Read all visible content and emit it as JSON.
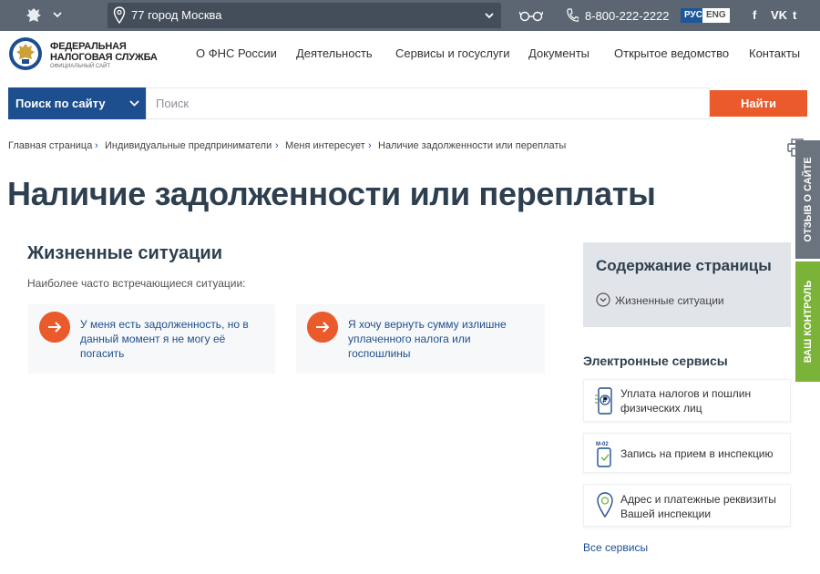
{
  "topbar": {
    "region": "77 город Москва",
    "phone": "8-800-222-2222",
    "lang_ru": "РУС",
    "lang_en": "ENG",
    "social": {
      "facebook": "f",
      "vk": "VK",
      "twitter": "t"
    }
  },
  "header": {
    "logo_line1": "ФЕДЕРАЛЬНАЯ",
    "logo_line2": "НАЛОГОВАЯ СЛУЖБА",
    "logo_line3": "ОФИЦИАЛЬНЫЙ САЙТ",
    "nav": [
      "О ФНС России",
      "Деятельность",
      "Сервисы и госуслуги",
      "Документы",
      "Открытое ведомство",
      "Контакты"
    ]
  },
  "search": {
    "scope": "Поиск по сайту",
    "placeholder": "Поиск",
    "button": "Найти"
  },
  "breadcrumb": [
    "Главная страница",
    "Индивидуальные предприниматели",
    "Меня интересует",
    "Наличие задолженности или переплаты"
  ],
  "side_tabs": {
    "feedback": "ОТЗЫВ О САЙТЕ",
    "control": "ВАШ КОНТРОЛЬ"
  },
  "page_title": "Наличие задолженности или переплаты",
  "main": {
    "section_title": "Жизненные ситуации",
    "section_sub": "Наиболее часто встречающиеся ситуации:",
    "cards": [
      {
        "lines": [
          "У меня есть задолженность, но в",
          "данный момент я не могу её",
          "погасить"
        ]
      },
      {
        "lines": [
          "Я хочу вернуть сумму излишне",
          "уплаченного налога или",
          "госпошлины"
        ]
      }
    ]
  },
  "toc": {
    "title": "Содержание страницы",
    "item": "Жизненные ситуации"
  },
  "services": {
    "title": "Электронные сервисы",
    "items": [
      {
        "lines": [
          "Уплата налогов и пошлин",
          "физических лиц"
        ]
      },
      {
        "lines": [
          "Запись на прием в инспекцию"
        ],
        "icon_label": "М-02"
      },
      {
        "lines": [
          "Адрес и платежные реквизиты",
          "Вашей инспекции"
        ]
      }
    ],
    "all": "Все сервисы"
  },
  "colors": {
    "topbar": "#5b6672",
    "brand_blue": "#1d4f8e",
    "accent_orange": "#ea5a2b",
    "control_green": "#7ab338"
  }
}
